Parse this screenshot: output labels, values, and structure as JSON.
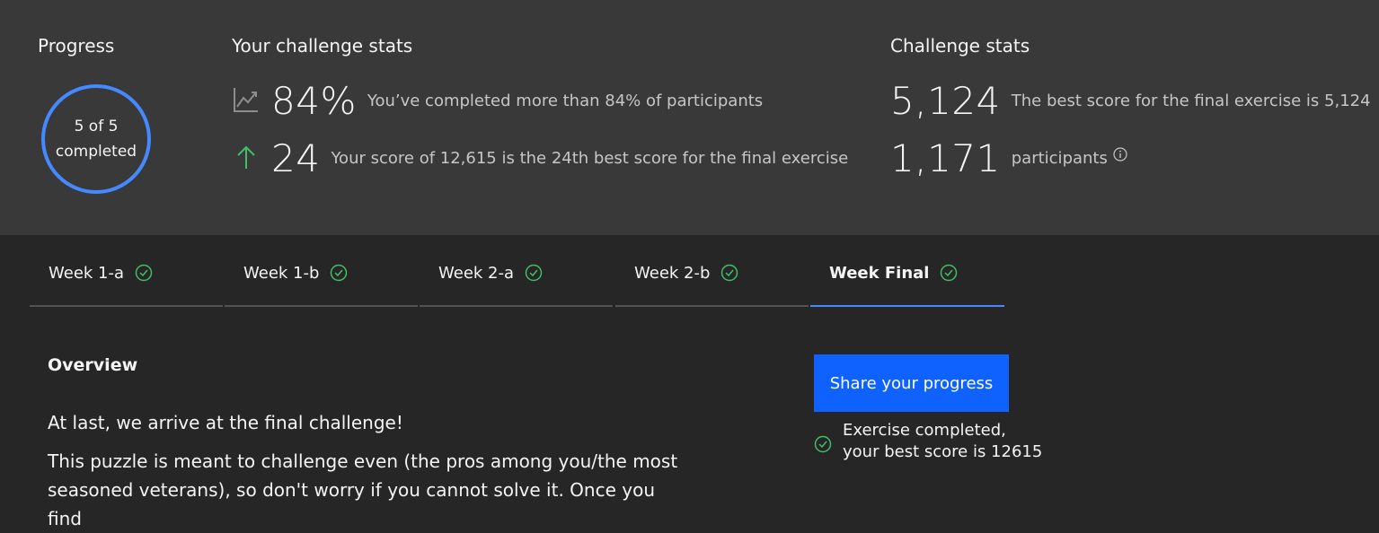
{
  "progress": {
    "title": "Progress",
    "ring_line1": "5 of 5",
    "ring_line2": "completed",
    "completed": 5,
    "total": 5
  },
  "your_stats": {
    "title": "Your challenge stats",
    "percent_value": "84%",
    "percent_desc": "You’ve completed more than 84% of participants",
    "rank_value": "24",
    "rank_desc": "Your score of 12,615 is the 24th best score for the final exercise"
  },
  "challenge_stats": {
    "title": "Challenge stats",
    "best_value": "5,124",
    "best_desc": "The best score for the final exercise is 5,124",
    "participants_value": "1,171",
    "participants_desc": "participants"
  },
  "tabs": [
    {
      "label": "Week 1-a",
      "active": false
    },
    {
      "label": "Week 1-b",
      "active": false
    },
    {
      "label": "Week 2-a",
      "active": false
    },
    {
      "label": "Week 2-b",
      "active": false
    },
    {
      "label": "Week Final",
      "active": true
    }
  ],
  "content": {
    "overview_title": "Overview",
    "para1": "At last, we arrive at the final challenge!",
    "para2": "This puzzle is meant to challenge even (the pros among you/the most seasoned veterans), so don't worry if you cannot solve it. Once you find"
  },
  "share": {
    "button_label": "Share your progress",
    "status_line1": "Exercise completed,",
    "status_line2": "your best score is 12615"
  },
  "colors": {
    "accent_blue": "#4589ff",
    "button_blue": "#0f62fe",
    "success_green": "#42be65",
    "top_bg": "#393939",
    "main_bg": "#262626"
  }
}
